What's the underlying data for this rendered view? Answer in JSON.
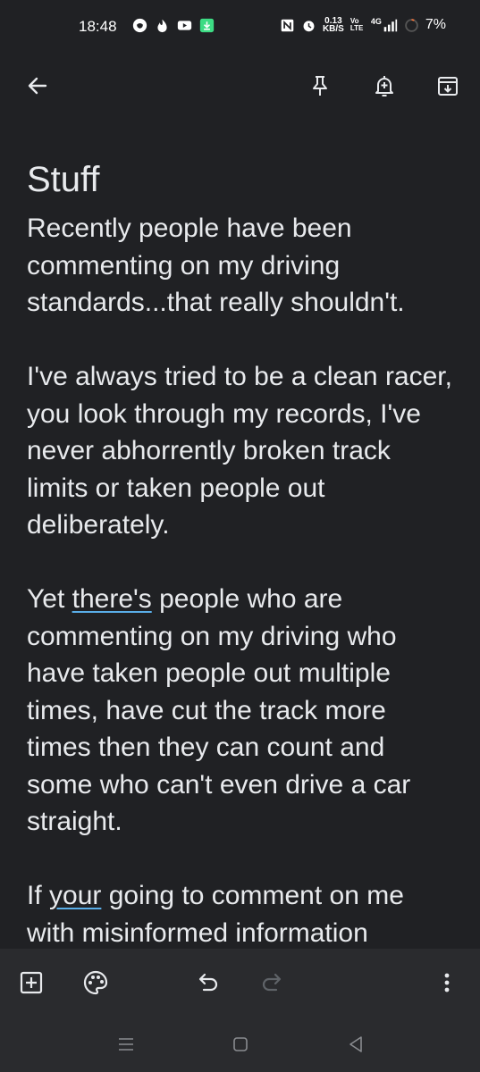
{
  "status_bar": {
    "time": "18:48",
    "speed_value": "0.13",
    "speed_unit": "KB/S",
    "volte": "Vo LTE",
    "network": "4G",
    "battery": "7%",
    "icons_left": [
      "snapchat-icon",
      "tinder-icon",
      "youtube-icon",
      "download-icon"
    ],
    "icons_right": [
      "nfc-icon",
      "alarm-icon",
      "volte-icon",
      "signal-icon",
      "battery-icon"
    ]
  },
  "toolbar": {
    "back_icon": "arrow-left-icon",
    "pin_icon": "pin-icon",
    "reminder_icon": "bell-plus-icon",
    "archive_icon": "archive-icon"
  },
  "note": {
    "title": "Stuff",
    "paragraphs": [
      "Recently people have been commenting on my driving standards...that really shouldn't.",
      "I've always tried to be a clean racer, you look through my records, I've never abhorrently broken track limits or taken people out deliberately.",
      "Yet there's people who are commenting on my driving who have taken people out multiple times, have cut the track more times then they can count and some who can't even drive a car straight.",
      "If your going to comment on me with misinformed information"
    ],
    "p3_start": "Yet ",
    "p3_underlined": "there's",
    "p3_rest": " people who are commenting on my driving who have taken people out multiple times, have cut the track more times then they can count and some who can't even drive a car straight.",
    "p4_start": "If ",
    "p4_underlined": "your",
    "p4_rest": " going to comment on me with misinformed information"
  },
  "bottom_bar": {
    "icons": [
      "add-box-icon",
      "palette-icon",
      "undo-icon",
      "redo-icon",
      "more-vert-icon"
    ]
  },
  "nav_bar": {
    "icons": [
      "recents-icon",
      "home-icon",
      "back-icon"
    ]
  },
  "colors": {
    "background": "#202124",
    "text": "#e8eaed",
    "bottom_bar": "#2a2b2e",
    "spellcheck_underline": "#5aaee8"
  }
}
